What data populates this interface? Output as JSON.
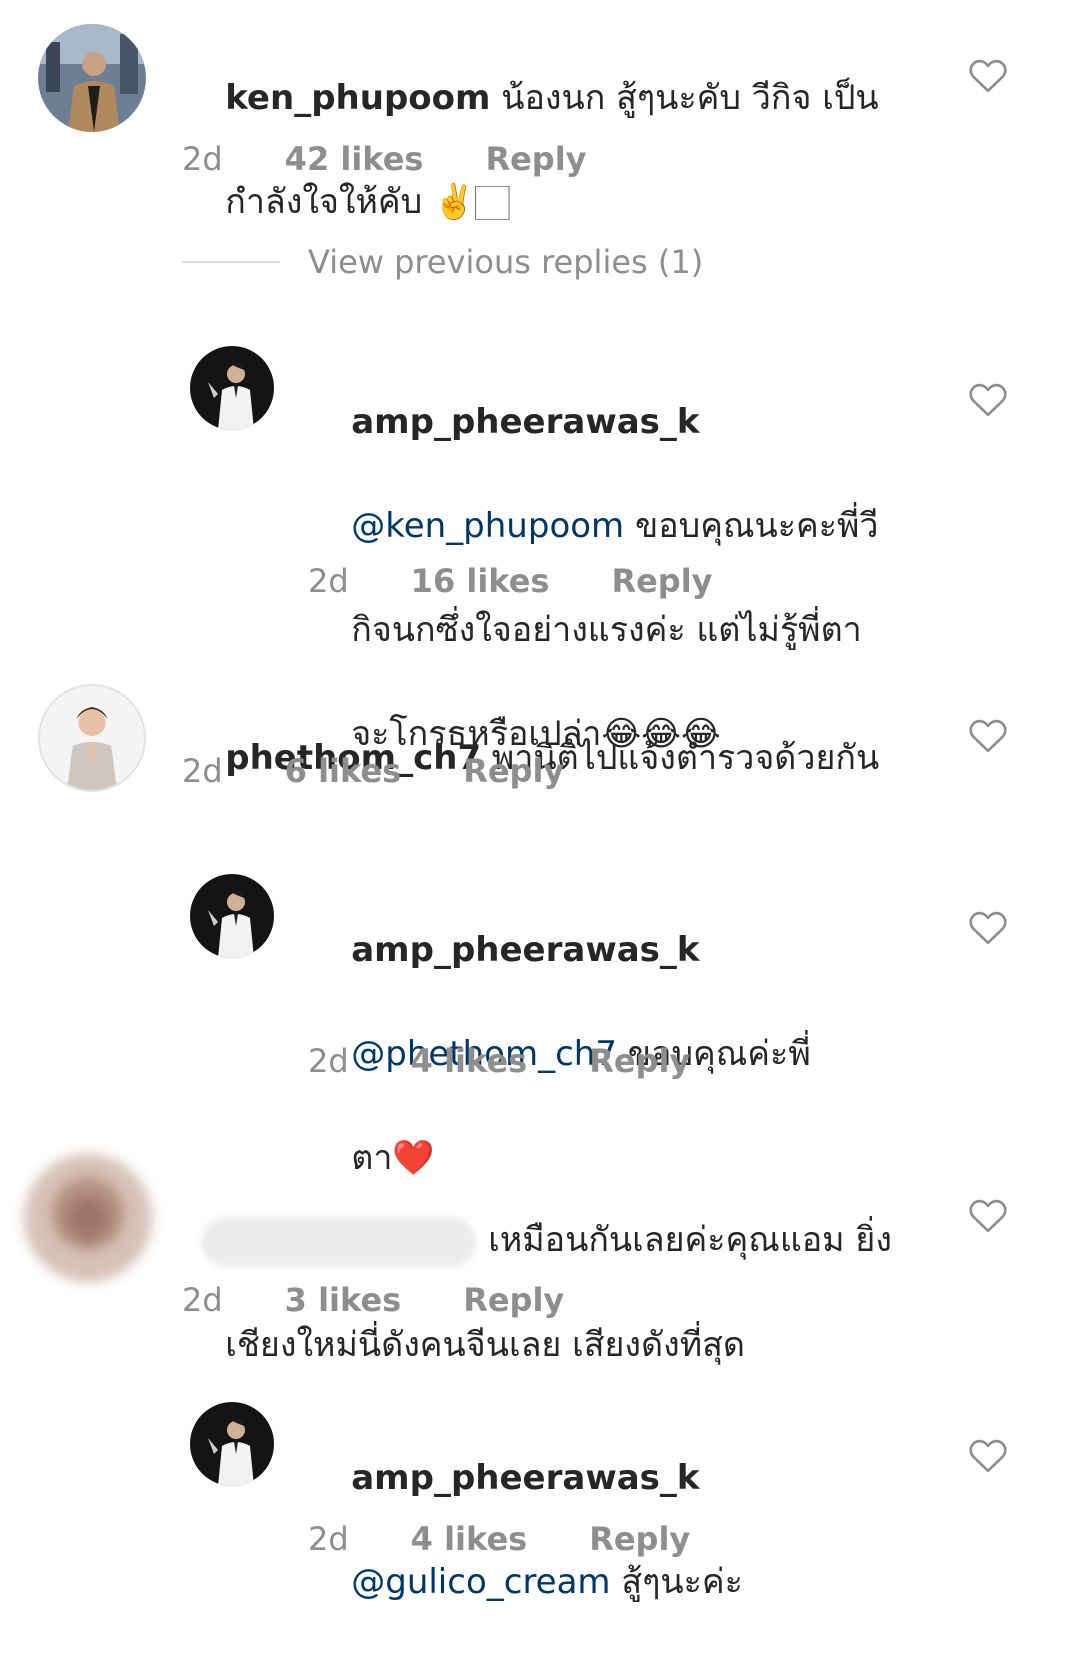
{
  "comments": [
    {
      "username": "ken_phupoom",
      "text_line1": "น้องนก สู้ๆนะคับ วีกิจ เป็น",
      "text_line2": "กำลังใจให้คับ ✌️🏻",
      "time": "2d",
      "likes": "42 likes",
      "reply": "Reply"
    },
    {
      "username": "amp_pheerawas_k",
      "mention": "@ken_phupoom",
      "text_line1": " ขอบคุณนะคะพี่วี",
      "text_line2": "กิจนกซึ่งใจอย่างแรงค่ะ แต่ไม่รู้พี่ตา",
      "text_line3": "จะโกรธหรือเปล่า😂😂😂",
      "time": "2d",
      "likes": "16 likes",
      "reply": "Reply"
    },
    {
      "username": "phethom_ch7",
      "text_line1": " พานิติไปแจ้งตำรวจด้วยกัน",
      "time": "2d",
      "likes": "6 likes",
      "reply": "Reply"
    },
    {
      "username": "amp_pheerawas_k",
      "mention": "@phethom_ch7",
      "text_line1": " ขอบคุณค่ะพี่",
      "text_line2": "ตา❤️",
      "time": "2d",
      "likes": "4 likes",
      "reply": "Reply"
    },
    {
      "text_line1": "เหมือนกันเลยค่ะคุณแอม ยิ่ง",
      "text_line2": "เชียงใหม่นี่ดังคนจีนเลย เสียงดังที่สุด",
      "time": "2d",
      "likes": "3 likes",
      "reply": "Reply"
    },
    {
      "username": "amp_pheerawas_k",
      "mention": "@gulico_cream",
      "text_line1": " สู้ๆนะค่ะ",
      "time": "2d",
      "likes": "4 likes",
      "reply": "Reply"
    }
  ],
  "view_previous_replies": "View previous replies (1)",
  "icons": {
    "like": "heart-outline-icon"
  },
  "colors": {
    "text": "#262626",
    "secondary": "#8e8e8e",
    "mention": "#00376b",
    "divider": "#dbdbdb"
  }
}
